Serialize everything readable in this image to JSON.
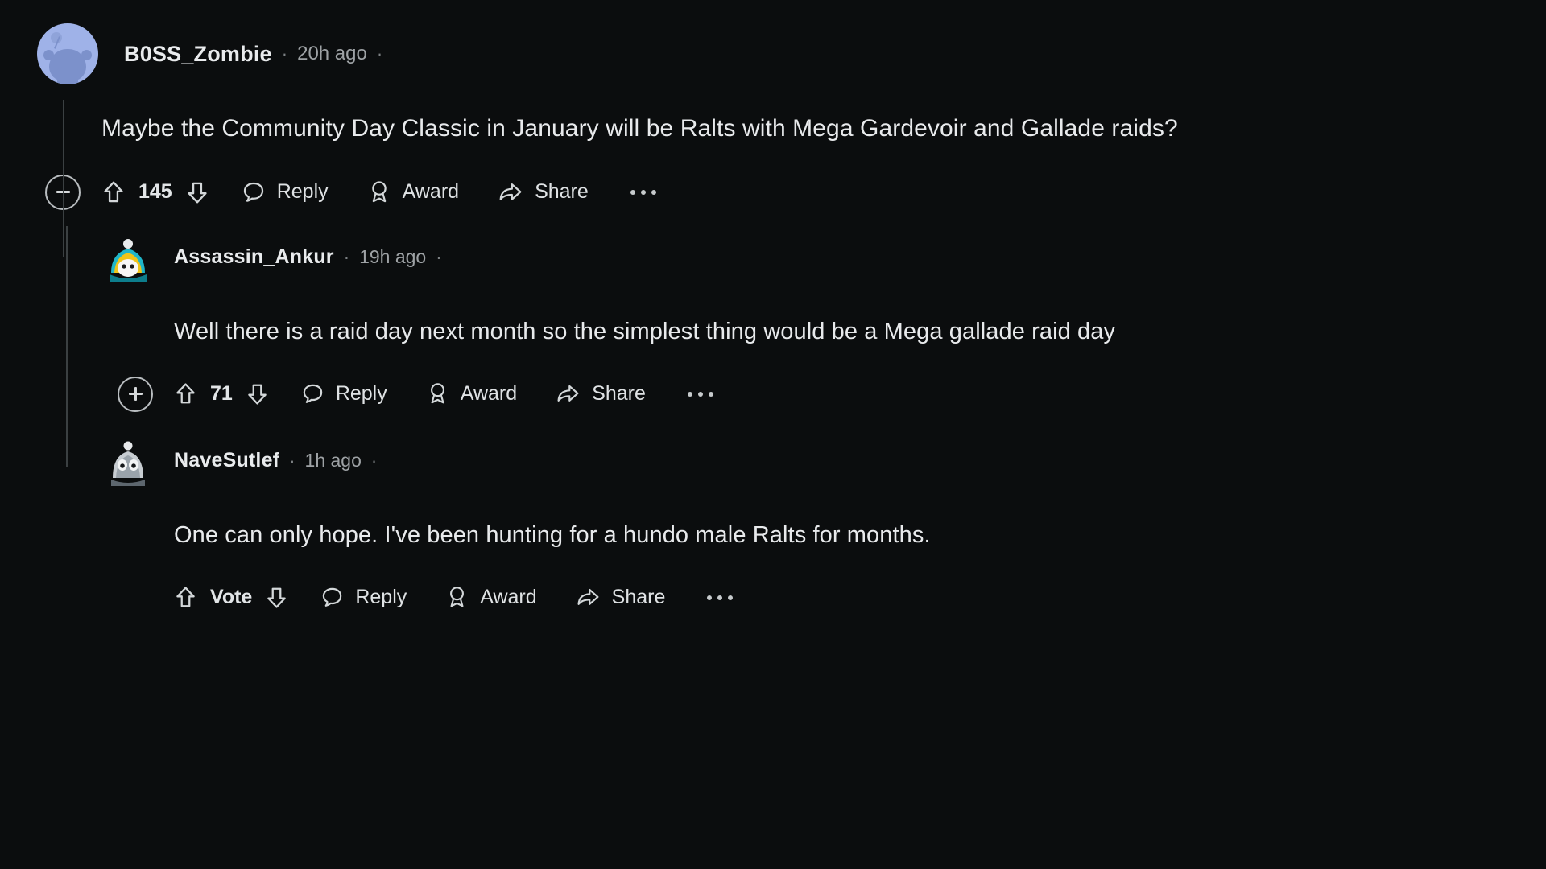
{
  "theme": {
    "background": "#0b0d0e",
    "text_primary": "#e8eaec",
    "text_secondary": "#9ea2a5",
    "thread_line": "#3b4042",
    "icon": "#c9cdd0"
  },
  "comments": [
    {
      "id": "c0",
      "depth": 0,
      "username": "B0SS_Zombie",
      "timestamp": "20h ago",
      "separator": "·",
      "body": "Maybe the Community Day Classic in January will be Ralts with Mega Gardevoir and Gallade raids?",
      "avatar_type": "reddit-snoo-avatar",
      "collapse_icon": "minus-circle-icon",
      "collapse_state": "expanded",
      "vote_count": "145",
      "upvote_icon": "upvote-arrow-icon",
      "downvote_icon": "downvote-arrow-icon",
      "actions": [
        {
          "label": "Reply",
          "icon": "comment-bubble-icon"
        },
        {
          "label": "Award",
          "icon": "award-medal-icon"
        },
        {
          "label": "Share",
          "icon": "share-arrow-icon"
        }
      ],
      "overflow_label": "…"
    },
    {
      "id": "c1",
      "depth": 1,
      "username": "Assassin_Ankur",
      "timestamp": "19h ago",
      "separator": "·",
      "body": "Well there is a raid day next month so the simplest thing would be a Mega gallade raid day",
      "avatar_type": "custom-blonde-character-avatar",
      "collapse_icon": "plus-circle-icon",
      "collapse_state": "collapsed",
      "vote_count": "71",
      "upvote_icon": "upvote-arrow-icon",
      "downvote_icon": "downvote-arrow-icon",
      "actions": [
        {
          "label": "Reply",
          "icon": "comment-bubble-icon"
        },
        {
          "label": "Award",
          "icon": "award-medal-icon"
        },
        {
          "label": "Share",
          "icon": "share-arrow-icon"
        }
      ],
      "overflow_label": "…"
    },
    {
      "id": "c2",
      "depth": 1,
      "username": "NaveSutlef",
      "timestamp": "1h ago",
      "separator": "·",
      "body": "One can only hope. I've been hunting for a hundo male Ralts for months.",
      "avatar_type": "custom-grey-creature-avatar",
      "collapse_icon": "none",
      "collapse_state": "none",
      "vote_count": "Vote",
      "upvote_icon": "upvote-arrow-icon",
      "downvote_icon": "downvote-arrow-icon",
      "actions": [
        {
          "label": "Reply",
          "icon": "comment-bubble-icon"
        },
        {
          "label": "Award",
          "icon": "award-medal-icon"
        },
        {
          "label": "Share",
          "icon": "share-arrow-icon"
        }
      ],
      "overflow_label": "…"
    }
  ]
}
